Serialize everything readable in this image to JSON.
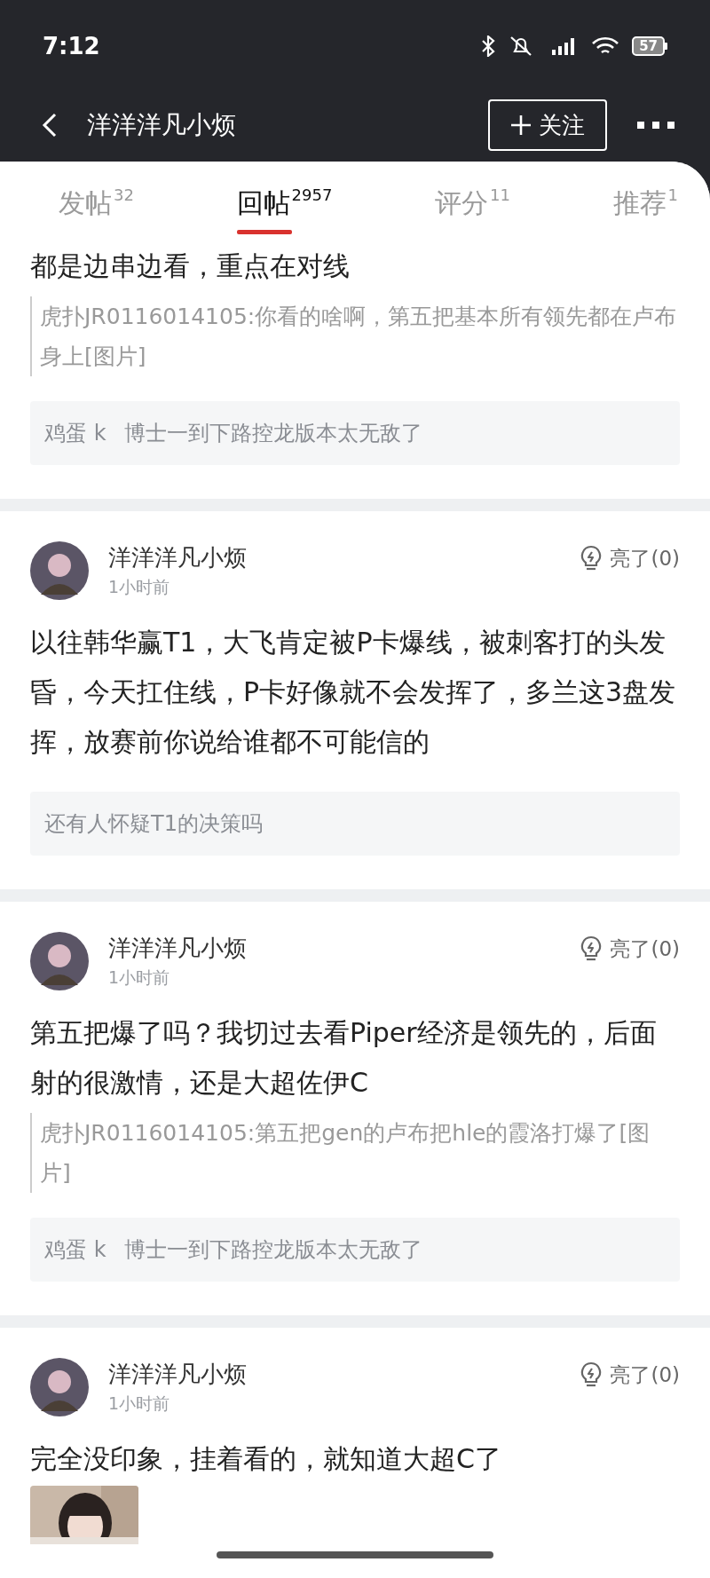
{
  "status_bar": {
    "time": "7:12",
    "battery": "57"
  },
  "header": {
    "title": "洋洋洋凡小烦",
    "follow_button": "关注"
  },
  "tabs": [
    {
      "label": "发帖",
      "count": "32",
      "selected": false
    },
    {
      "label": "回帖",
      "count": "2957",
      "selected": true
    },
    {
      "label": "评分",
      "count": "11",
      "selected": false
    },
    {
      "label": "推荐",
      "count": "1",
      "selected": false
    }
  ],
  "posts": [
    {
      "body": "都是边串边看，重点在对线",
      "quote": "虎扑JR0116014105:你看的啥啊，第五把基本所有领先都在卢布身上[图片]",
      "reply": {
        "author": "鸡蛋 k",
        "text": "博士一到下路控龙版本太无敌了"
      }
    },
    {
      "author": "洋洋洋凡小烦",
      "time": "1小时前",
      "like": "亮了(0)",
      "body": "以往韩华赢T1，大飞肯定被P卡爆线，被刺客打的头发昏，今天扛住线，P卡好像就不会发挥了，多兰这3盘发挥，放赛前你说给谁都不可能信的",
      "reply": {
        "text": "还有人怀疑T1的决策吗"
      }
    },
    {
      "author": "洋洋洋凡小烦",
      "time": "1小时前",
      "like": "亮了(0)",
      "body": "第五把爆了吗？我切过去看Piper经济是领先的，后面射的很激情，还是大超佐伊C",
      "quote": "虎扑JR0116014105:第五把gen的卢布把hle的霞洛打爆了[图片]",
      "reply": {
        "author": "鸡蛋 k",
        "text": "博士一到下路控龙版本太无敌了"
      }
    },
    {
      "author": "洋洋洋凡小烦",
      "time": "1小时前",
      "like": "亮了(0)",
      "body": "完全没印象，挂着看的，就知道大超C了"
    }
  ]
}
